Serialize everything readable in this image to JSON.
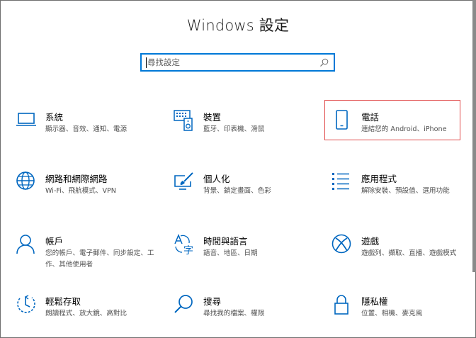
{
  "window": {
    "title": "Windows 設定"
  },
  "search": {
    "placeholder": "尋找設定",
    "value": ""
  },
  "colors": {
    "accent": "#0078d7",
    "highlight": "#e04a4a"
  },
  "tiles": [
    {
      "name": "系統",
      "desc": "顯示器、音效、通知、電源",
      "icon": "laptop-icon"
    },
    {
      "name": "裝置",
      "desc": "藍牙、印表機、滑鼠",
      "icon": "devices-icon"
    },
    {
      "name": "電話",
      "desc": "連結您的 Android、iPhone",
      "icon": "phone-icon"
    },
    {
      "name": "網路和網際網路",
      "desc": "Wi-Fi、飛航模式、VPN",
      "icon": "globe-icon"
    },
    {
      "name": "個人化",
      "desc": "背景、鎖定畫面、色彩",
      "icon": "personalization-icon"
    },
    {
      "name": "應用程式",
      "desc": "解除安裝、預設值、選用功能",
      "icon": "apps-icon"
    },
    {
      "name": "帳戶",
      "desc": "您的帳戶、電子郵件、同步設定、工作、其他使用者",
      "icon": "person-icon"
    },
    {
      "name": "時間與語言",
      "desc": "語音、地區、日期",
      "icon": "time-language-icon"
    },
    {
      "name": "遊戲",
      "desc": "遊戲列、擷取、直播、遊戲模式",
      "icon": "xbox-icon"
    },
    {
      "name": "輕鬆存取",
      "desc": "朗讀程式、放大鏡、高對比",
      "icon": "ease-of-access-icon"
    },
    {
      "name": "搜尋",
      "desc": "尋找我的檔案、權限",
      "icon": "search-large-icon"
    },
    {
      "name": "隱私權",
      "desc": "位置、相機、麥克風",
      "icon": "lock-icon"
    }
  ]
}
